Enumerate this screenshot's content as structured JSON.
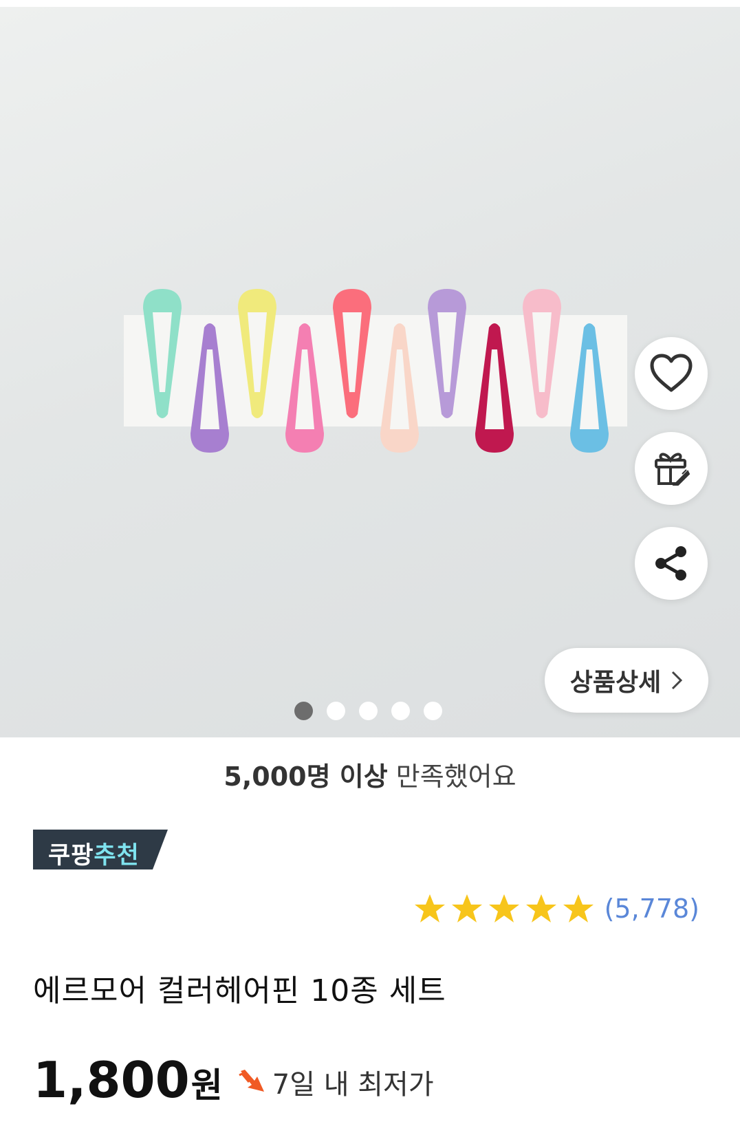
{
  "gallery": {
    "image_alt": "에르모어 컬러헤어핀 10종 세트",
    "dots": [
      "1",
      "2",
      "3",
      "4",
      "5"
    ],
    "active_index": 0,
    "detail_button_label": "상품상세",
    "actions": {
      "wishlist_icon": "heart-icon",
      "gift_icon": "gift-icon",
      "share_icon": "share-icon"
    },
    "hairpin_colors": [
      "#8fe0c8",
      "#a77fd0",
      "#f0ea7c",
      "#f47fb2",
      "#fb6e7c",
      "#f9d6c8",
      "#b79ad8",
      "#c0184f",
      "#f7bcca",
      "#6bbfe4"
    ]
  },
  "satisfaction": {
    "bold": "5,000명 이상",
    "normal": "만족했어요"
  },
  "badge": {
    "part1": "쿠팡",
    "part2": "추천",
    "bg_color": "#2e3a46",
    "accent_color": "#7fe3ef"
  },
  "rating": {
    "stars": 5,
    "count": "(5,778)",
    "star_color": "#f7c51b"
  },
  "product": {
    "title": "에르모어 컬러헤어핀 10종 세트",
    "price": "1,800",
    "price_unit": "원",
    "lowest_price_label": "7일 내 최저가",
    "lowest_icon": "down-arrow-icon",
    "lowest_icon_color": "#f05a24"
  }
}
